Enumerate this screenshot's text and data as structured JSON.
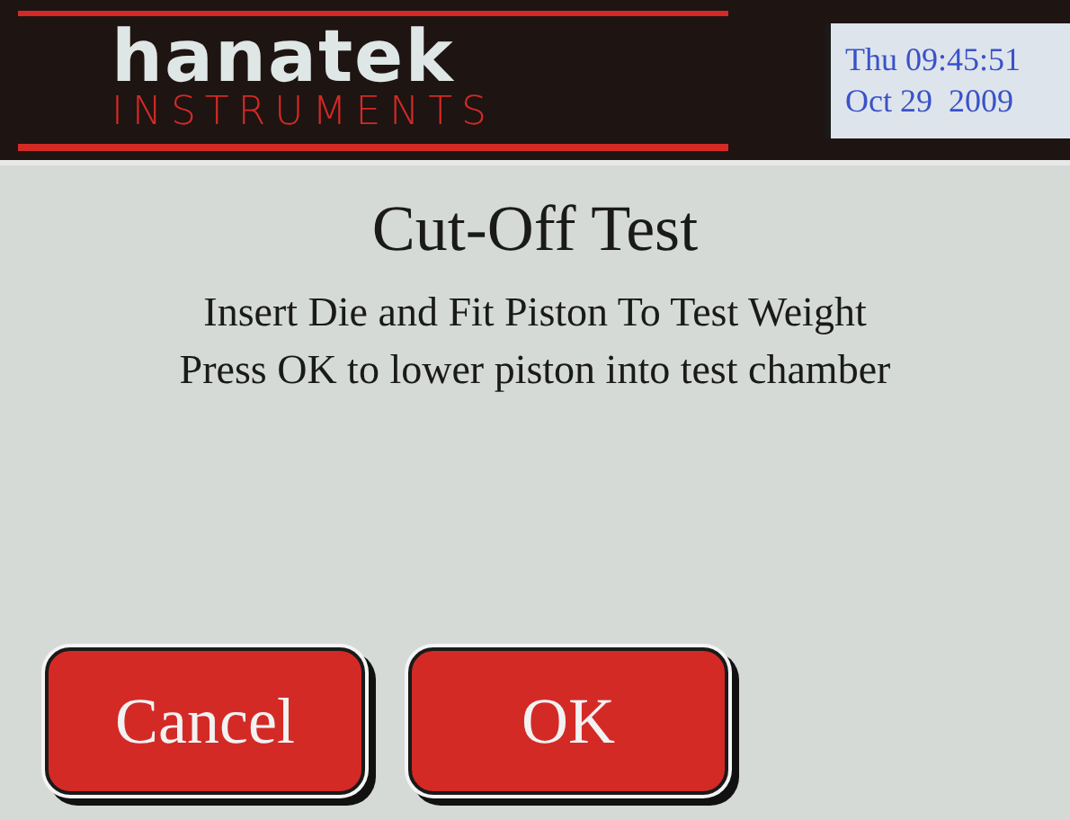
{
  "header": {
    "logo_name": "hanatek",
    "logo_tagline": "INSTRUMENTS",
    "clock": {
      "time": "Thu 09:45:51",
      "date": "Oct 29  2009"
    }
  },
  "title": "Cut-Off Test",
  "instructions": [
    "Insert Die and Fit Piston To Test Weight",
    "Press OK to lower piston into test chamber"
  ],
  "buttons": [
    "Cancel",
    "OK"
  ]
}
